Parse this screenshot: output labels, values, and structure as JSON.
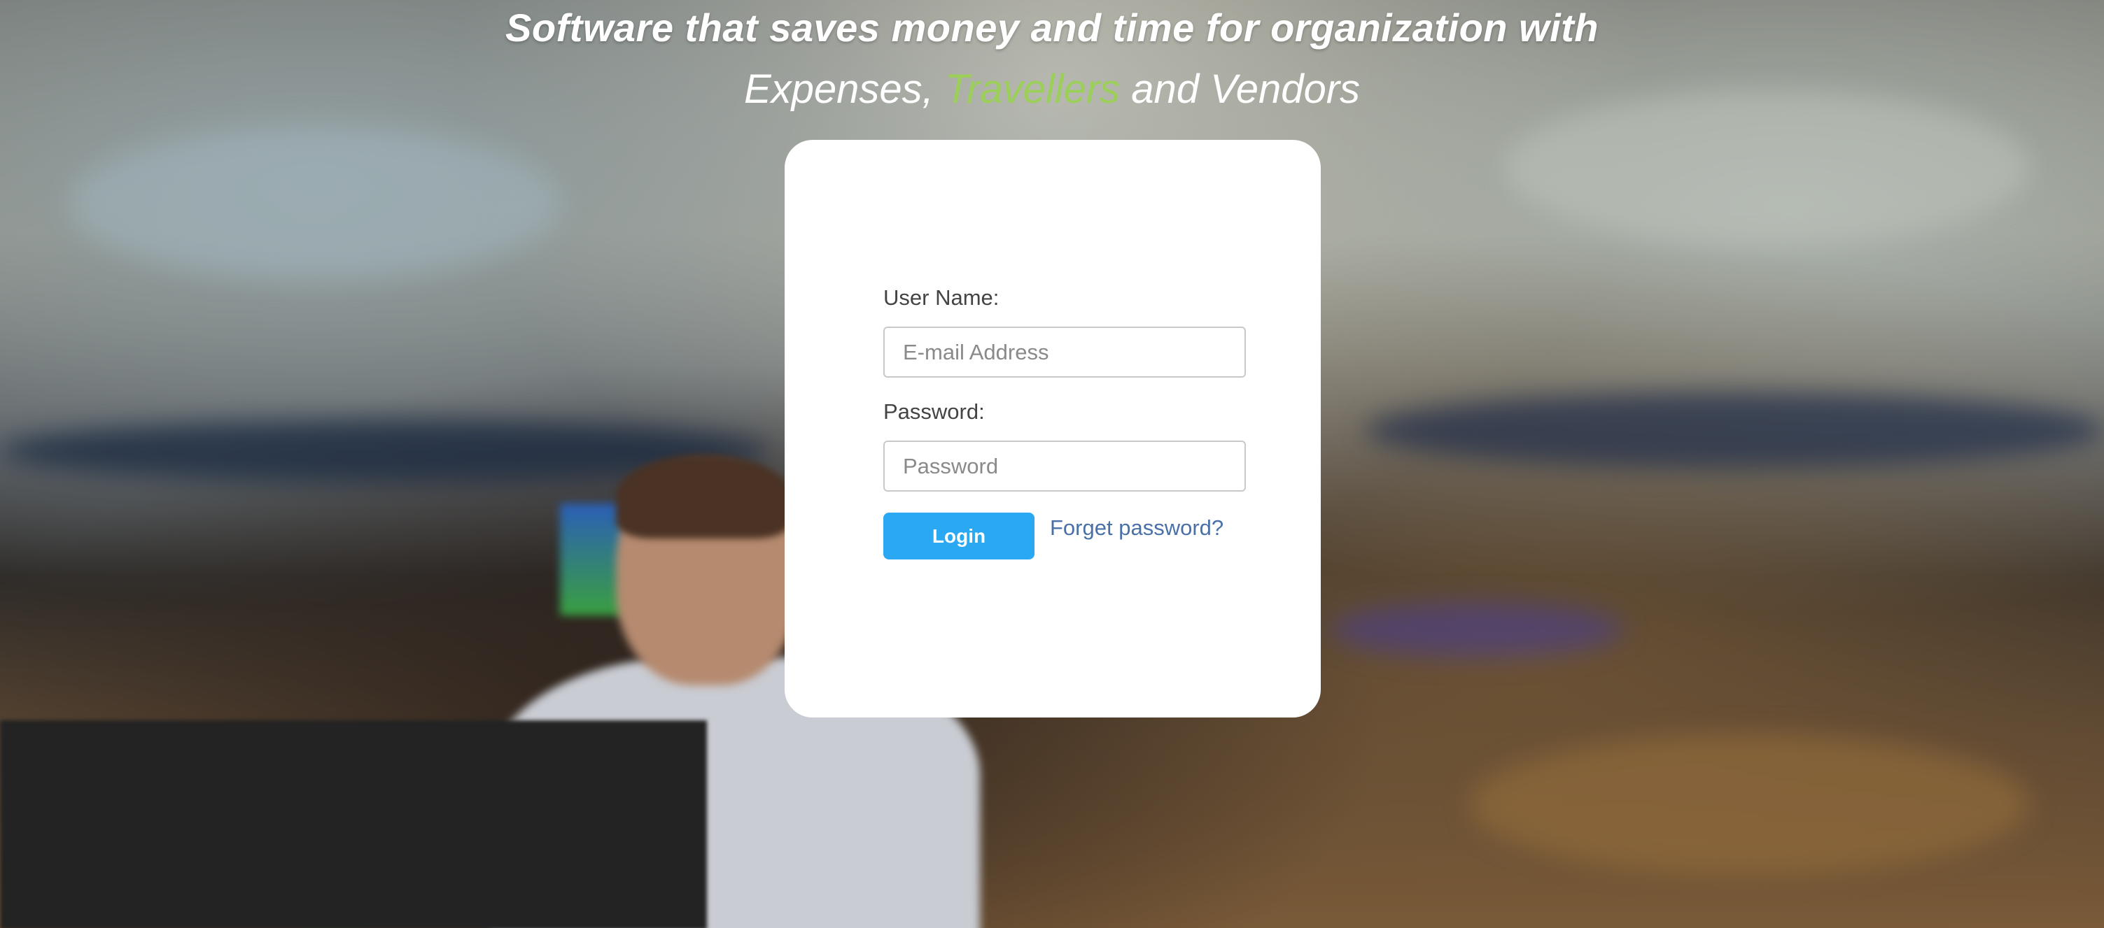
{
  "hero": {
    "headline": "Software that saves money and time for organization with",
    "subline_part1": "Expenses, ",
    "subline_accent": "Travellers",
    "subline_part2": " and Vendors"
  },
  "login_form": {
    "username_label": "User Name:",
    "username_placeholder": "E-mail Address",
    "username_value": "",
    "password_label": "Password:",
    "password_placeholder": "Password",
    "password_value": "",
    "login_button": "Login",
    "forgot_link": "Forget password?"
  },
  "colors": {
    "accent_green": "#9ccf5a",
    "login_button": "#2aa8f2",
    "link": "#4a70a8",
    "card_background": "#ffffff"
  }
}
